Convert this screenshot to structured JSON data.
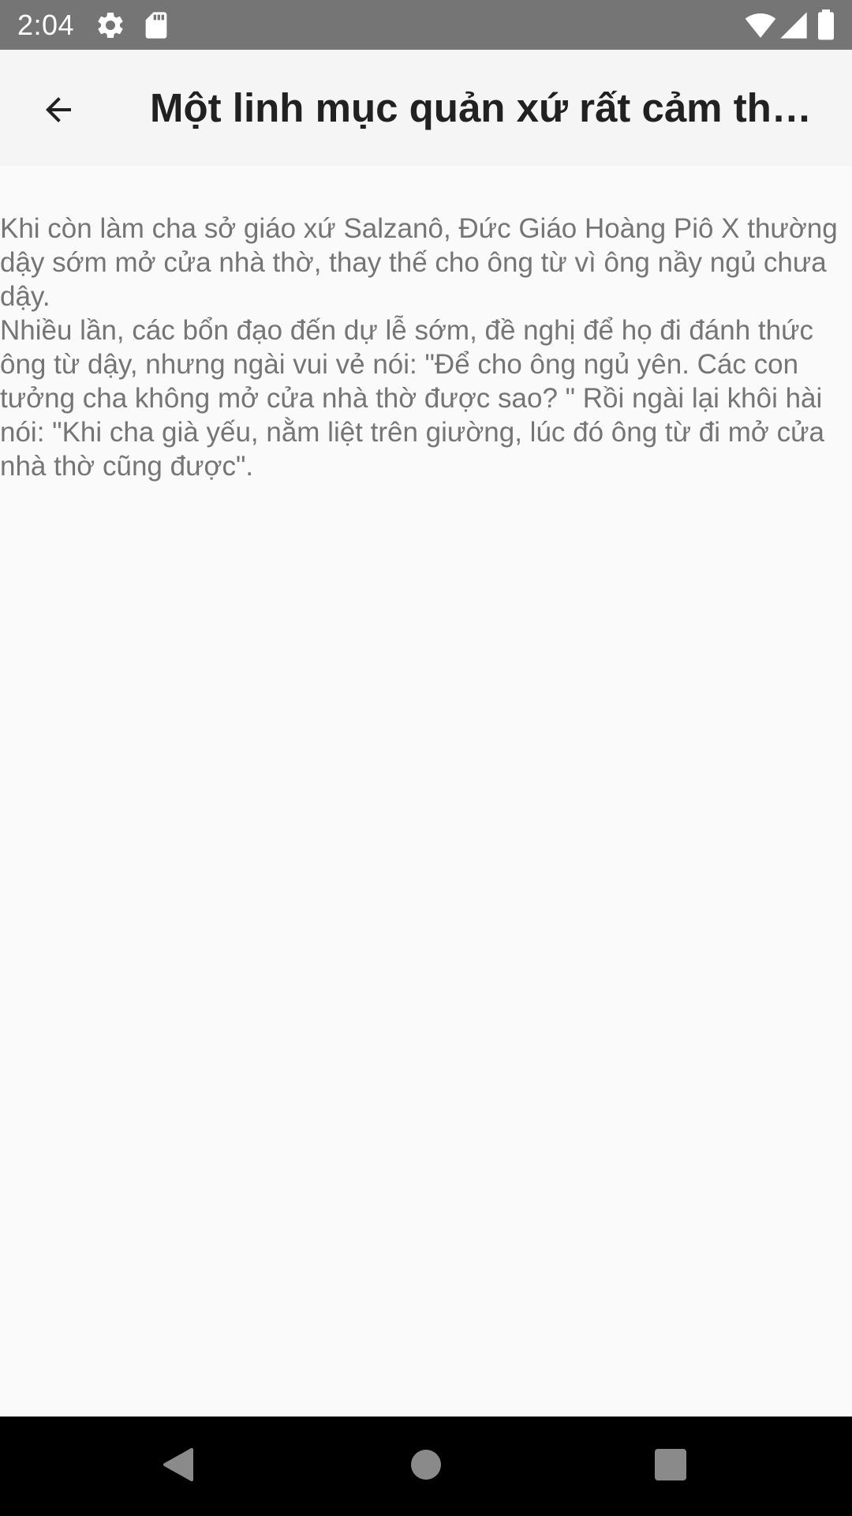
{
  "status_bar": {
    "time": "2:04",
    "icons": [
      "gear-icon",
      "sd-card-icon",
      "wifi-icon",
      "signal-icon",
      "battery-icon"
    ]
  },
  "app_bar": {
    "back_icon": "arrow-back-icon",
    "title": "Một linh mục quản xứ rất cảm thông với người khác"
  },
  "content": {
    "paragraphs": [
      "Khi còn làm cha sở giáo xứ Salzanô, Đức Giáo Hoàng Piô X thường dậy sớm mở cửa nhà thờ, thay thế cho ông từ vì ông nầy ngủ chưa dậy.",
      "Nhiều lần, các bổn đạo đến dự lễ sớm, đề nghị để họ đi đánh thức ông từ dậy, nhưng ngài vui vẻ nói: \"Để cho ông ngủ yên. Các con tưởng cha không mở cửa nhà thờ được sao? \" Rồi ngài lại khôi hài nói: \"Khi cha già yếu, nằm liệt trên giường, lúc đó ông từ đi mở cửa nhà thờ cũng được\"."
    ]
  },
  "nav_bar": {
    "icons": [
      "back-triangle-icon",
      "home-circle-icon",
      "recents-square-icon"
    ]
  },
  "colors": {
    "status_bar_bg": "#757575",
    "app_bar_bg": "#f5f5f5",
    "page_bg": "#fafafa",
    "title_text": "#212121",
    "body_text": "#757575",
    "nav_bar_bg": "#000000"
  }
}
